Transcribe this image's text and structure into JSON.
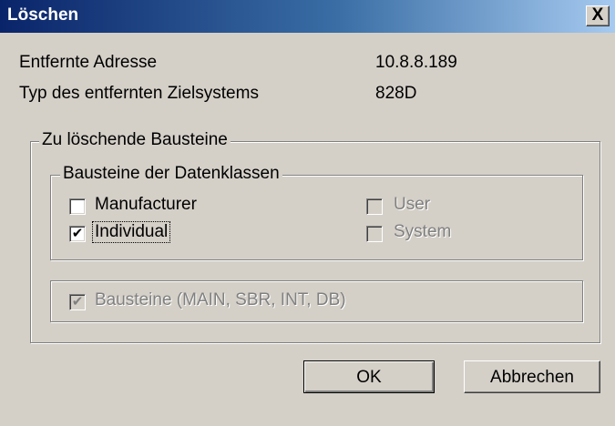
{
  "dialog": {
    "title": "Löschen",
    "close_glyph": "X"
  },
  "info": {
    "remote_address_label": "Entfernte Adresse",
    "remote_address_value": "10.8.8.189",
    "target_type_label": "Typ des entfernten Zielsystems",
    "target_type_value": "828D"
  },
  "delete_group": {
    "title": "Zu löschende Bausteine",
    "data_classes": {
      "title": "Bausteine der Datenklassen",
      "manufacturer": {
        "label": "Manufacturer",
        "checked": false,
        "enabled": true
      },
      "individual": {
        "label": "Individual",
        "checked": true,
        "enabled": true
      },
      "user": {
        "label": "User",
        "checked": false,
        "enabled": false
      },
      "system": {
        "label": "System",
        "checked": false,
        "enabled": false
      }
    },
    "blocks": {
      "label": "Bausteine (MAIN, SBR, INT, DB)",
      "checked": true,
      "enabled": false
    }
  },
  "buttons": {
    "ok": "OK",
    "cancel": "Abbrechen"
  },
  "check_glyph": "✔"
}
